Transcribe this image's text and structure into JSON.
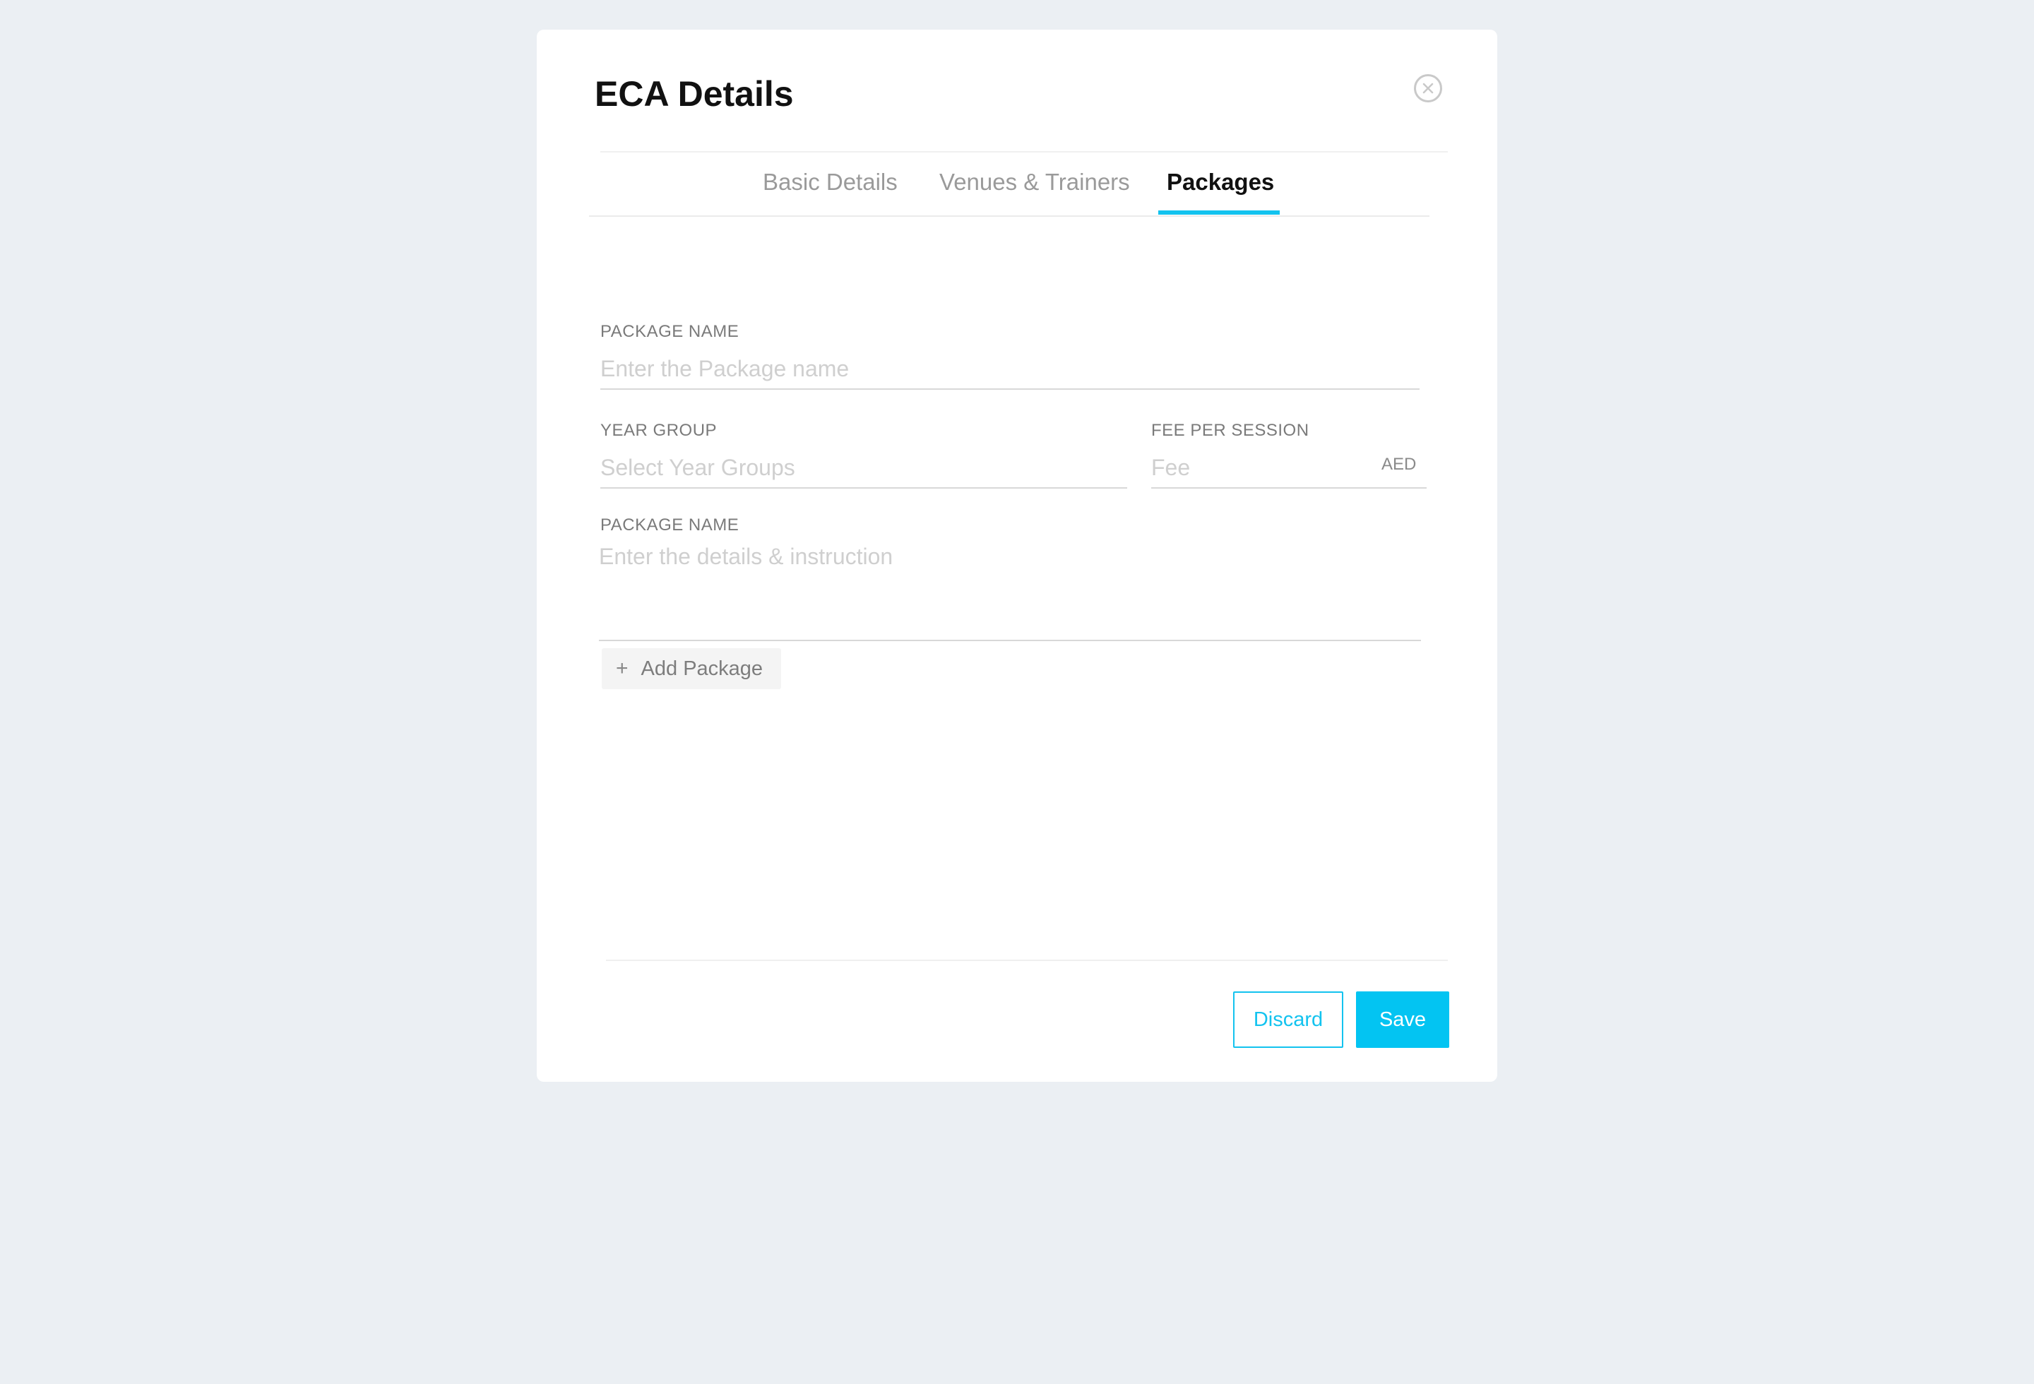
{
  "modal": {
    "title": "ECA Details"
  },
  "tabs": [
    {
      "label": "Basic Details",
      "active": false
    },
    {
      "label": "Venues & Trainers",
      "active": false
    },
    {
      "label": "Packages",
      "active": true
    }
  ],
  "form": {
    "package_name": {
      "label": "PACKAGE NAME",
      "placeholder": "Enter the Package name",
      "value": ""
    },
    "year_group": {
      "label": "YEAR GROUP",
      "placeholder": "Select Year Groups",
      "value": ""
    },
    "fee_per_session": {
      "label": "FEE PER SESSION",
      "placeholder": "Fee",
      "value": "",
      "currency": "AED"
    },
    "details": {
      "label": "PACKAGE NAME",
      "placeholder": "Enter the details & instruction",
      "value": ""
    },
    "add_package_label": "Add Package"
  },
  "footer": {
    "discard_label": "Discard",
    "save_label": "Save"
  },
  "colors": {
    "accent": "#13c3ef",
    "page_background": "#ebeff3"
  },
  "icons": {
    "close": "close-circle-icon",
    "add": "plus-icon"
  }
}
